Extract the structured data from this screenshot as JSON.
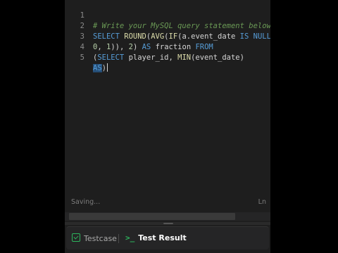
{
  "editor": {
    "lines": [
      {
        "number": "1",
        "comment": "# Write your MySQL query statement below"
      },
      {
        "number": "2",
        "t1": "SELECT",
        "t2": " ",
        "t3": "ROUND",
        "t4": "(",
        "t5": "AVG",
        "t6": "(",
        "t7": "IF",
        "t8": "(a.event_date ",
        "t9": "IS",
        "t10": " ",
        "t11": "NULL",
        "t12": ","
      },
      {
        "number": "3",
        "t1": "0",
        "t2": ", ",
        "t3": "1",
        "t4": ")), ",
        "t5": "2",
        "t6": ") ",
        "t7": "AS",
        "t8": " fraction ",
        "t9": "FROM"
      },
      {
        "number": "4",
        "t1": "(",
        "t2": "SELECT",
        "t3": " player_id, ",
        "t4": "MIN",
        "t5": "(event_date)"
      },
      {
        "number": "5",
        "t1": "AS",
        "t2": ")"
      }
    ]
  },
  "status": {
    "left": "Saving...",
    "right": "Ln"
  },
  "tabs": {
    "testcase": "Testcase",
    "result": "Test Result"
  },
  "icons": {
    "testcase": "checkbox-icon",
    "result": "terminal-icon"
  },
  "colors": {
    "editor_bg": "#1e1e1e",
    "keyword": "#569cd6",
    "function": "#dcdcaa",
    "comment": "#6a9955",
    "accent_green": "#2db55d"
  }
}
